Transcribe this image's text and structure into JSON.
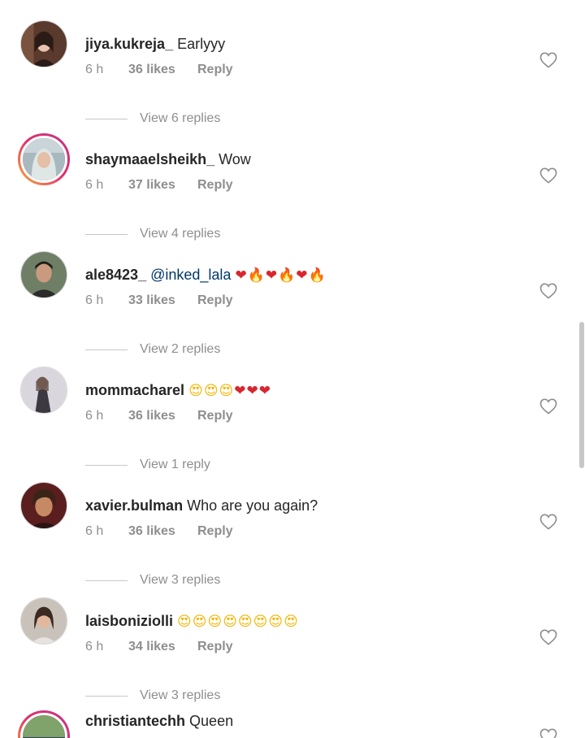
{
  "comments": [
    {
      "username": "jiya.kukreja_",
      "text": "Earlyyy",
      "time": "6 h",
      "likes": "36 likes",
      "reply_label": "Reply",
      "view_replies": "View 6 replies"
    },
    {
      "username": "shaymaaelsheikh_",
      "text": "Wow",
      "time": "6 h",
      "likes": "37 likes",
      "reply_label": "Reply",
      "view_replies": "View 4 replies"
    },
    {
      "username": "ale8423_",
      "mention": "@inked_lala",
      "emojis": "red-heart, fire, red-heart, fire, red-heart, fire",
      "time": "6 h",
      "likes": "33 likes",
      "reply_label": "Reply",
      "view_replies": "View 2 replies"
    },
    {
      "username": "mommacharel",
      "emojis": "heart-eyes, heart-eyes, heart-eyes, red-heart, red-heart, red-heart",
      "time": "6 h",
      "likes": "36 likes",
      "reply_label": "Reply",
      "view_replies": "View 1 reply"
    },
    {
      "username": "xavier.bulman",
      "text": "Who are you again?",
      "time": "6 h",
      "likes": "36 likes",
      "reply_label": "Reply",
      "view_replies": "View 3 replies"
    },
    {
      "username": "laisboniziolli",
      "emojis": "heart-eyes x8",
      "time": "6 h",
      "likes": "34 likes",
      "reply_label": "Reply",
      "view_replies": "View 3 replies"
    },
    {
      "username": "christiantechh",
      "text": "Queen"
    }
  ],
  "colors": {
    "text": "#262626",
    "secondary": "#8e8e8e",
    "mention": "#00376b",
    "story_ring": "#e1306c"
  },
  "icons": {
    "like": "heart-outline-icon"
  }
}
